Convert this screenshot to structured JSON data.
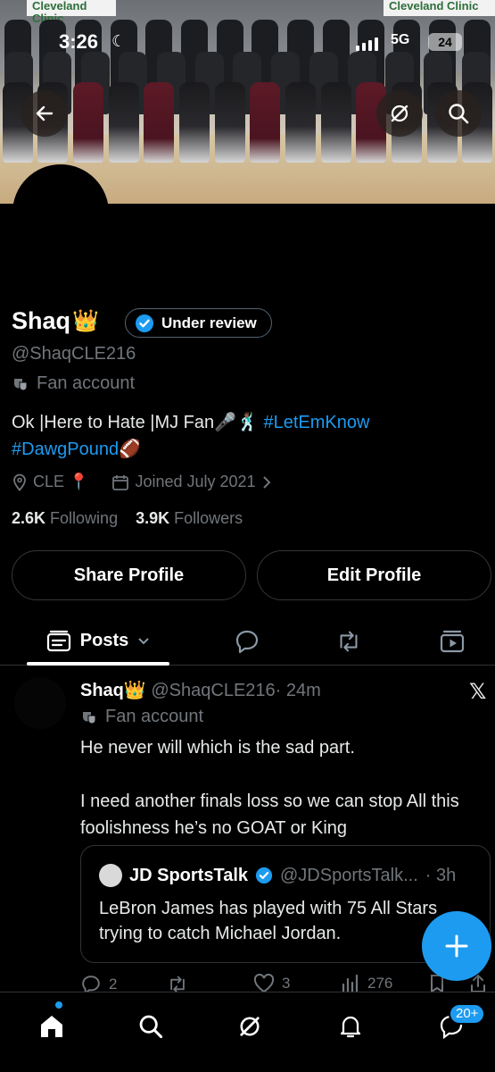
{
  "status_bar": {
    "time": "3:26",
    "network": "5G",
    "battery": "24"
  },
  "banner": {
    "sign_left": "Cleveland Clinic",
    "sign_right": "Cleveland Clinic"
  },
  "profile": {
    "name": "Shaq",
    "crown": "👑",
    "verification_label": "Under review",
    "handle": "@ShaqCLE216",
    "account_label": "Fan account",
    "bio_line1": "Ok |Here to Hate |MJ Fan🎤🕺🏾 ",
    "bio_hashtag1": "#LetEmKnow",
    "bio_hashtag2": "#DawgPound",
    "bio_emoji": "🏈",
    "location": "CLE 📍",
    "joined": "Joined July 2021",
    "following_count": "2.6K",
    "following_label": "Following",
    "followers_count": "3.9K",
    "followers_label": "Followers"
  },
  "buttons": {
    "share": "Share Profile",
    "edit": "Edit Profile"
  },
  "tabs": {
    "posts": "Posts"
  },
  "post": {
    "author_name": "Shaq",
    "author_crown": "👑",
    "author_handle": "@ShaqCLE216",
    "time": "· 24m",
    "account_label": "Fan account",
    "text_line1": "He never will which is the sad part.",
    "text_line2": "I need another finals loss so we can stop All this foolishness he’s no GOAT or King",
    "quote": {
      "name": "JD SportsTalk",
      "handle": "@JDSportsTalk...",
      "time": "· 3h",
      "text": "LeBron James has played with 75 All Stars trying to catch Michael Jordan."
    },
    "replies": "2",
    "likes": "3",
    "views": "276"
  },
  "bottom_nav": {
    "messages_badge": "20+"
  },
  "colors": {
    "accent": "#1d9bf0",
    "muted": "#71767b",
    "background": "#000000"
  }
}
